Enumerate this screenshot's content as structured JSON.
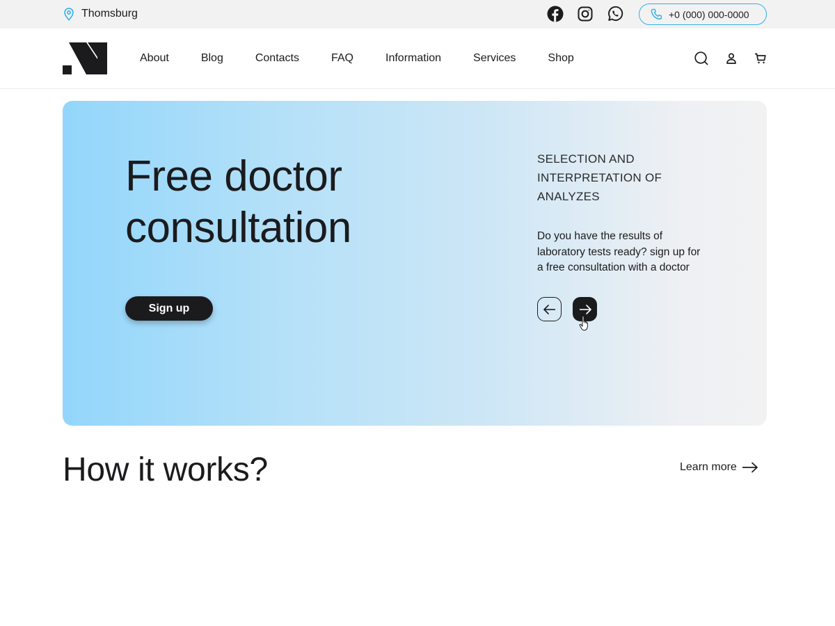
{
  "topbar": {
    "location": "Thomsburg",
    "location_icon": "map-pin-icon",
    "socials": [
      "facebook-icon",
      "instagram-icon",
      "whatsapp-icon"
    ],
    "phone": "+0 (000) 000-0000",
    "accent_color": "#33b0e6"
  },
  "header": {
    "logo_icon": "brand-logo",
    "nav": [
      "About",
      "Blog",
      "Contacts",
      "FAQ",
      "Information",
      "Services",
      "Shop"
    ],
    "icons": [
      "search-icon",
      "user-icon",
      "cart-icon"
    ]
  },
  "hero": {
    "title": "Free doctor consultation",
    "signup_label": "Sign up",
    "subtitle": "SELECTION AND INTERPRETATION OF ANALYZES",
    "description": "Do you have the results of laboratory tests ready? sign up for a free consultation with a doctor",
    "gradient_start": "#93d6fb",
    "gradient_end": "#f2f2f3"
  },
  "how": {
    "title": "How it works?",
    "learn_more": "Learn more"
  }
}
